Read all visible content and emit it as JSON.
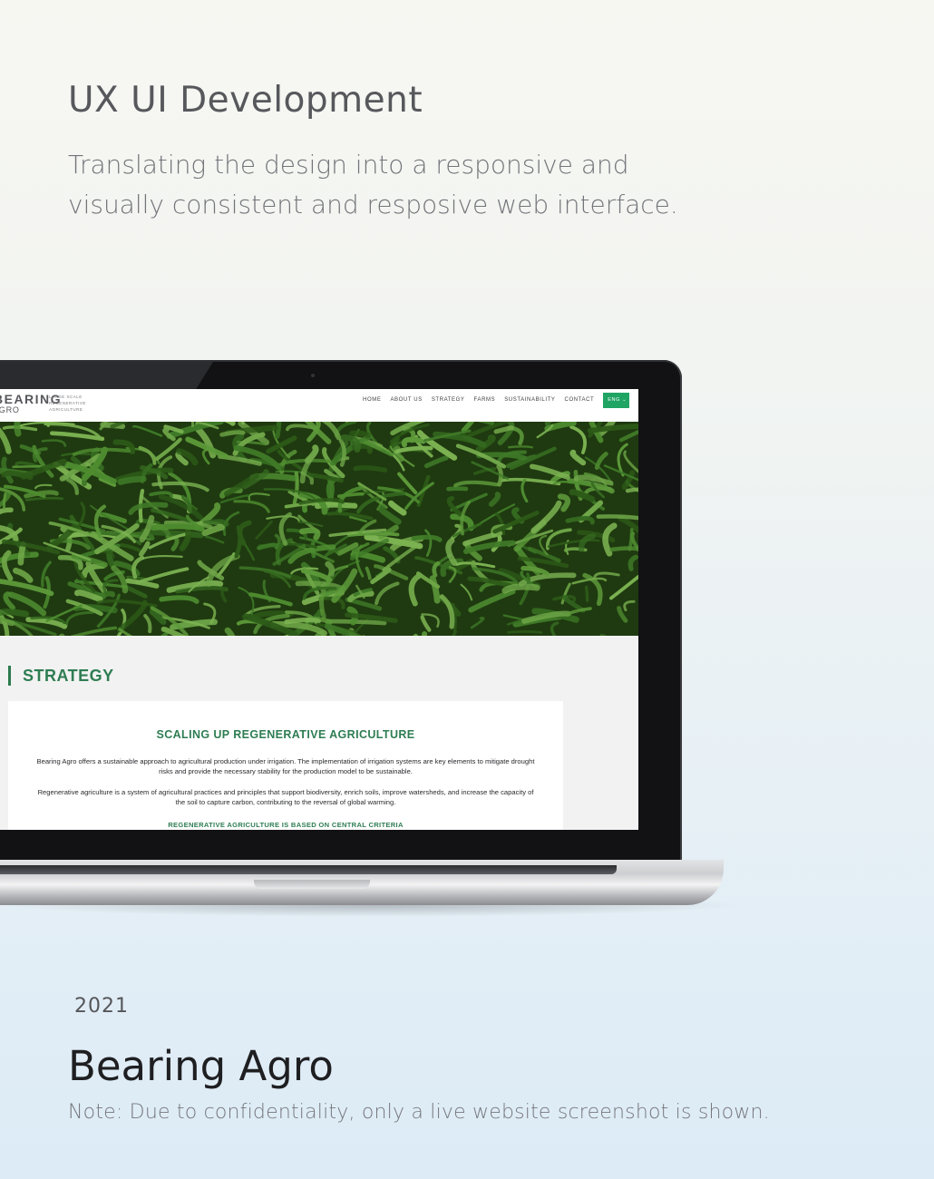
{
  "intro": {
    "heading": "UX UI Development",
    "description": "Translating the design into a responsive and visually consistent and resposive web interface."
  },
  "website": {
    "logo": {
      "name_line1": "BEARING",
      "name_line2": "AGRO",
      "tagline": "LARGE SCALE REGENERATIVE AGRICULTURE"
    },
    "nav": {
      "items": [
        "HOME",
        "ABOUT US",
        "STRATEGY",
        "FARMS",
        "SUSTAINABILITY",
        "CONTACT"
      ],
      "language": "ENG"
    },
    "hero": {
      "image": "cornfield-photo",
      "colors": {
        "leaf": "#3f7a28",
        "leaf_light": "#6fa648",
        "shadow": "#1f3a10"
      }
    },
    "section_label": "STRATEGY",
    "card": {
      "title": "SCALING UP REGENERATIVE AGRICULTURE",
      "paragraph1": "Bearing Agro offers a sustainable approach to agricultural production under irrigation. The implementation of irrigation systems are key elements to mitigate drought risks and provide the necessary stability for the production model to be sustainable.",
      "paragraph2": "Regenerative agriculture is a system of agricultural practices and principles that support biodiversity, enrich soils, improve watersheds, and increase the capacity of the soil to capture carbon, contributing to the reversal of global warming.",
      "subheading": "REGENERATIVE AGRICULTURE IS BASED ON CENTRAL CRITERIA"
    },
    "colors": {
      "brand_green": "#2e7d52",
      "button_green": "#1fa463"
    }
  },
  "project": {
    "year": "2021",
    "title": "Bearing Agro",
    "note": "Note: Due to confidentiality, only a live website screenshot is shown."
  }
}
